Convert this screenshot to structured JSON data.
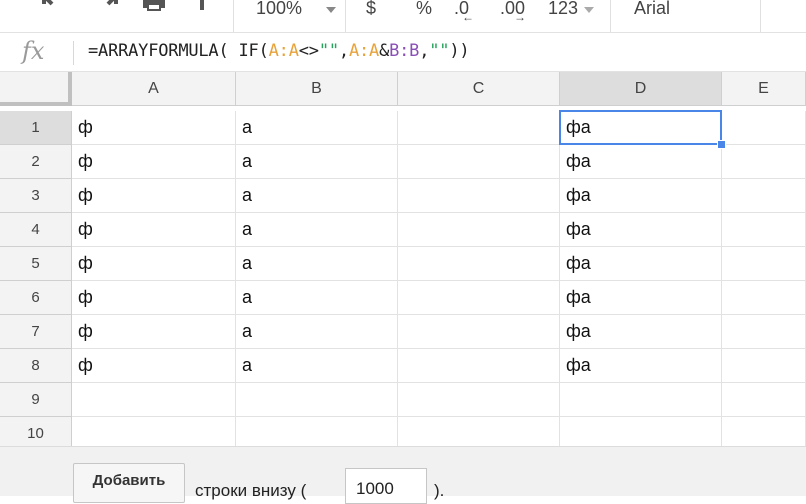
{
  "toolbar": {
    "zoom": "100%",
    "currency": "$",
    "percent": "%",
    "decrease_decimals": ".0",
    "increase_decimals": ".00",
    "more_formats": "123",
    "font": "Arial"
  },
  "formula_bar": {
    "fx_label": "fx",
    "parts": {
      "p1": "=ARRAYFORMULA( IF(",
      "p2": "A:A",
      "p3": "<>",
      "p4": "\"\"",
      "p5": ",",
      "p6": "A:A",
      "p7": "&",
      "p8": "B:B",
      "p9": ",",
      "p10": "\"\"",
      "p11": "))"
    }
  },
  "sheet": {
    "columns": [
      "A",
      "B",
      "C",
      "D",
      "E"
    ],
    "rows": [
      "1",
      "2",
      "3",
      "4",
      "5",
      "6",
      "7",
      "8",
      "9",
      "10"
    ],
    "cells": [
      [
        "ф",
        "а",
        "",
        "фа"
      ],
      [
        "ф",
        "а",
        "",
        "фа"
      ],
      [
        "ф",
        "а",
        "",
        "фа"
      ],
      [
        "ф",
        "а",
        "",
        "фа"
      ],
      [
        "ф",
        "а",
        "",
        "фа"
      ],
      [
        "ф",
        "а",
        "",
        "фа"
      ],
      [
        "ф",
        "а",
        "",
        "фа"
      ],
      [
        "ф",
        "а",
        "",
        "фа"
      ],
      [
        "",
        "",
        "",
        ""
      ],
      [
        "",
        "",
        "",
        ""
      ]
    ],
    "selected_cell": "D1",
    "colors": {
      "selection": "#4a86e8",
      "ref_a": "#e8a23a",
      "ref_b": "#8a4fb7",
      "string": "#25a35a"
    }
  },
  "add_rows": {
    "button_label": "Добавить",
    "label_before": "строки внизу (",
    "count": "1000",
    "label_after": ")."
  }
}
